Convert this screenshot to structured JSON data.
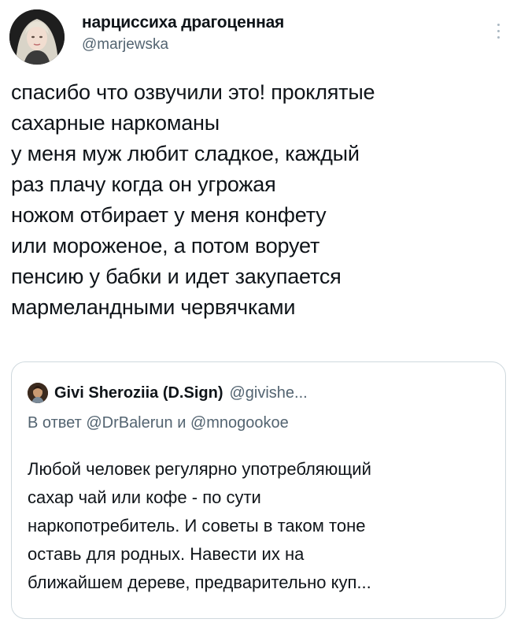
{
  "tweet": {
    "author": {
      "display_name": "нарциссиха драгоценная",
      "handle": "@marjewska",
      "avatar_icon": "avatar-photo"
    },
    "menu_icon": "more-vertical-icon",
    "lines": [
      "спасибо что озвучили это! проклятые",
      "сахарные наркоманы",
      "у меня муж любит сладкое, каждый",
      "раз плачу когда он угрожая",
      "ножом отбирает у меня конфету",
      "или мороженое, а потом ворует",
      "пенсию у бабки и идет закупается",
      "мармеландными червячками"
    ]
  },
  "quoted": {
    "author": {
      "display_name": "Givi Sheroziia (D.Sign)",
      "handle": "@givishe..."
    },
    "reply_to": "В ответ @DrBalerun и @mnogookoe",
    "lines": [
      "Любой человек регулярно употребляющий",
      "сахар чай или кофе - по сути",
      "наркопотребитель. И советы в таком тоне",
      "оставь для родных. Навести их на",
      "ближайшем дереве, предварительно куп..."
    ]
  },
  "colors": {
    "text": "#0f1419",
    "secondary": "#536471",
    "border": "#cfd9de"
  }
}
